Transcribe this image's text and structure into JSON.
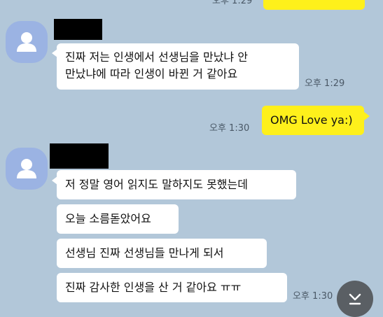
{
  "messages": {
    "top_partial": {
      "time": "오후 1:29"
    },
    "msg1": {
      "line1": "진짜 저는 인생에서 선생님을 만났냐 안",
      "line2": "만났냐에 따라 인생이 바뀐 거 같아요",
      "time": "오후 1:29"
    },
    "msg2": {
      "text": "OMG Love ya:)",
      "time": "오후 1:30"
    },
    "msg3": {
      "bubbles": [
        "저 정말 영어 읽지도 말하지도 못했는데",
        "오늘 소름돋았어요",
        "선생님 진짜 선생님들 만나게 되서",
        "진짜 감사한 인생을 산 거 같아요 ㅠㅠ"
      ],
      "time": "오후 1:30"
    }
  },
  "colors": {
    "background": "#b2c7d9",
    "incoming_bubble": "#ffffff",
    "outgoing_bubble": "#fef01b",
    "avatar": "#9bb3e3"
  },
  "icons": {
    "avatar": "default-profile-icon",
    "scroll": "chevron-down-to-bottom-icon"
  }
}
